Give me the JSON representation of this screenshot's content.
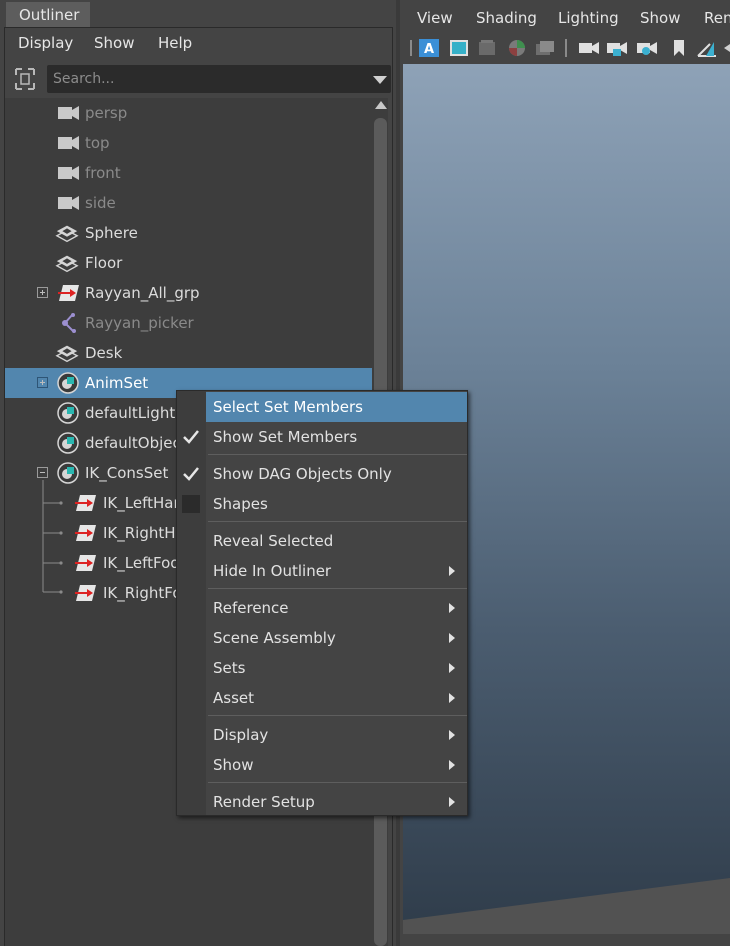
{
  "outliner": {
    "tab_label": "Outliner",
    "menu": [
      "Display",
      "Show",
      "Help"
    ],
    "search_placeholder": "Search...",
    "tree": [
      {
        "label": "persp",
        "icon": "camera-icon",
        "dim": true
      },
      {
        "label": "top",
        "icon": "camera-icon",
        "dim": true
      },
      {
        "label": "front",
        "icon": "camera-icon",
        "dim": true
      },
      {
        "label": "side",
        "icon": "camera-icon",
        "dim": true
      },
      {
        "label": "Sphere",
        "icon": "mesh-icon",
        "dim": false
      },
      {
        "label": "Floor",
        "icon": "mesh-icon",
        "dim": false
      },
      {
        "label": "Rayyan_All_grp",
        "icon": "transform-icon",
        "dim": false
      },
      {
        "label": "Rayyan_picker",
        "icon": "joint-icon",
        "dim": true
      },
      {
        "label": "Desk",
        "icon": "mesh-icon",
        "dim": false
      },
      {
        "label": "AnimSet",
        "icon": "set-icon",
        "dim": false
      },
      {
        "label": "defaultLightS",
        "icon": "set-icon",
        "dim": false
      },
      {
        "label": "defaultObject",
        "icon": "set-icon",
        "dim": false
      },
      {
        "label": "IK_ConsSet",
        "icon": "set-icon",
        "dim": false
      },
      {
        "label": "IK_LeftHan",
        "icon": "ik-handle-icon",
        "dim": false
      },
      {
        "label": "IK_RightHa",
        "icon": "ik-handle-icon",
        "dim": false
      },
      {
        "label": "IK_LeftFoo",
        "icon": "ik-handle-icon",
        "dim": false
      },
      {
        "label": "IK_RightFo",
        "icon": "ik-handle-icon",
        "dim": false
      }
    ]
  },
  "viewport": {
    "menu": [
      "View",
      "Shading",
      "Lighting",
      "Show",
      "Ren"
    ]
  },
  "context_menu": {
    "items": [
      {
        "label": "Select Set Members",
        "highlighted": true
      },
      {
        "label": "Show Set Members",
        "checked": true
      },
      {
        "label": "Show DAG Objects Only",
        "checked": true
      },
      {
        "label": "Shapes",
        "checked": false
      },
      {
        "label": "Reveal Selected"
      },
      {
        "label": "Hide In Outliner",
        "submenu": true
      },
      {
        "label": "Reference",
        "submenu": true
      },
      {
        "label": "Scene Assembly",
        "submenu": true
      },
      {
        "label": "Sets",
        "submenu": true
      },
      {
        "label": "Asset",
        "submenu": true
      },
      {
        "label": "Display",
        "submenu": true
      },
      {
        "label": "Show",
        "submenu": true
      },
      {
        "label": "Render Setup",
        "submenu": true
      }
    ]
  },
  "colors": {
    "selection": "#5286ae",
    "panel": "#444444",
    "tree_bg": "#3d3d3d"
  }
}
